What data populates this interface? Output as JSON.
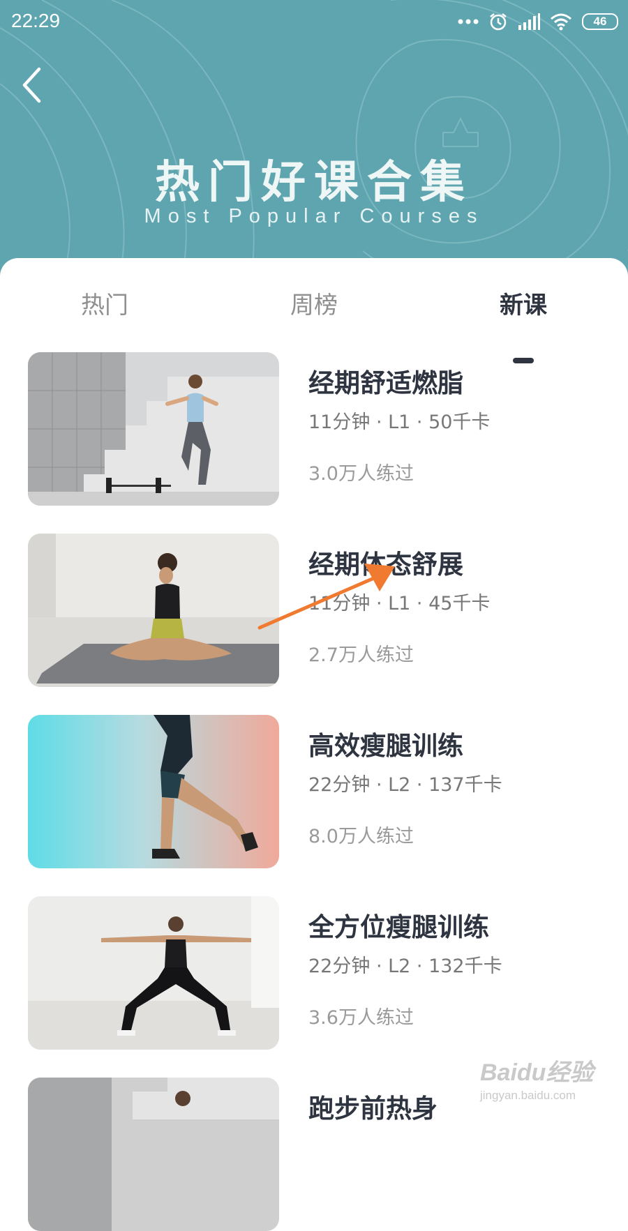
{
  "status_bar": {
    "time": "22:29",
    "battery": "46",
    "icons": [
      "more-dots-icon",
      "alarm-icon",
      "signal-icon",
      "wifi-icon",
      "battery-icon"
    ]
  },
  "header": {
    "back_icon": "chevron-left-icon",
    "title": "热门好课合集",
    "subtitle": "Most Popular Courses",
    "background_color": "#5fa5b0"
  },
  "tabs": [
    {
      "label": "热门",
      "active": false
    },
    {
      "label": "周榜",
      "active": false
    },
    {
      "label": "新课",
      "active": true
    }
  ],
  "courses": [
    {
      "title": "经期舒适燃脂",
      "meta": "11分钟 · L1 · 50千卡",
      "count": "3.0万人练过"
    },
    {
      "title": "经期体态舒展",
      "meta": "11分钟 · L1 · 45千卡",
      "count": "2.7万人练过"
    },
    {
      "title": "高效瘦腿训练",
      "meta": "22分钟 · L2 · 137千卡",
      "count": "8.0万人练过"
    },
    {
      "title": "全方位瘦腿训练",
      "meta": "22分钟 · L2 · 132千卡",
      "count": "3.6万人练过"
    },
    {
      "title": "跑步前热身",
      "meta": "",
      "count": ""
    }
  ],
  "annotation_color": "#f07a2f",
  "watermark": {
    "logo": "Baidu经验",
    "url": "jingyan.baidu.com"
  }
}
